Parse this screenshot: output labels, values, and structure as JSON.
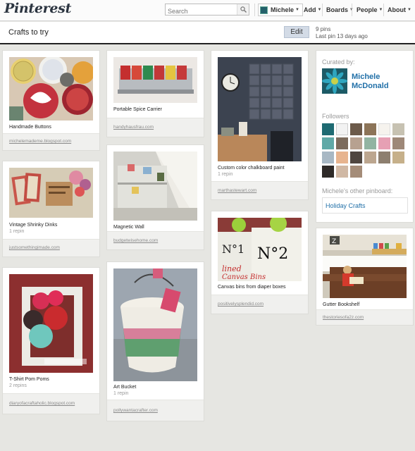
{
  "nav": {
    "logo": "Pinterest",
    "search_placeholder": "Search",
    "user": "Michele",
    "add": "Add",
    "boards": "Boards",
    "people": "People",
    "about": "About"
  },
  "board": {
    "title": "Crafts to try",
    "edit_label": "Edit",
    "pin_count": "9 pins",
    "last_pin": "Last pin 13 days ago"
  },
  "pins": [
    {
      "desc": "Handmade Buttons",
      "repins": "",
      "source": "michelemademe.blogspot.com",
      "image": "fabric buttons photo"
    },
    {
      "desc": "Vintage Shrinky Dinks",
      "repins": "1 repin",
      "source": "justsomethingimade.com",
      "image": "playing card shrinky dinks photo"
    },
    {
      "desc": "T-Shirt Pom Poms",
      "repins": "2 repins",
      "source": "diaryofacraftaholic.blogspot.com",
      "image": "pom poms in white frame photo"
    },
    {
      "desc": "Portable Spice Carrier",
      "repins": "",
      "source": "handyhausfrau.com",
      "image": "spice jars in tin photo"
    },
    {
      "desc": "Magnetic Wall",
      "repins": "",
      "source": "budgetwisehome.com",
      "image": "magnetic wall under stairs photo"
    },
    {
      "desc": "Art Bucket",
      "repins": "1 repin",
      "source": "pollywantacrafter.com",
      "image": "fabric covered bucket photo"
    },
    {
      "desc": "Custom color chalkboard paint",
      "repins": "1 repin",
      "source": "marthastewart.com",
      "image": "chalkboard wall with clock photo"
    },
    {
      "desc": "Canvas bins from diaper boxes",
      "repins": "",
      "source": "positivelysplendid.com",
      "image": "lined canvas bins photo"
    },
    {
      "desc": "Gutter Bookshelf",
      "repins": "",
      "source": "thestoriesofa2z.com",
      "image": "child reading by gutter shelf photo"
    }
  ],
  "sidebar": {
    "curated_label": "Curated by:",
    "curator_name": "Michele McDonald",
    "followers_label": "Followers",
    "other_pinboard_label": "Michele's other pinboard:",
    "other_pinboard": "Holiday Crafts"
  },
  "colors": {
    "background": "#e6e6e2",
    "link_blue": "#2170a8",
    "edit_button": "#d3dbe6"
  }
}
